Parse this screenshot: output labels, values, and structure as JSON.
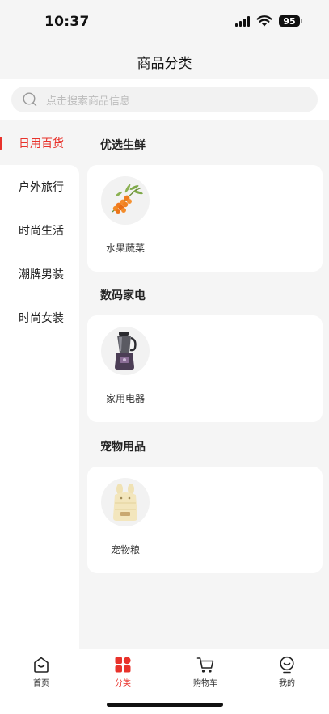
{
  "status_bar": {
    "time": "10:37",
    "battery": "95"
  },
  "header": {
    "title": "商品分类"
  },
  "search": {
    "placeholder": "点击搜索商品信息"
  },
  "sidebar": {
    "items": [
      {
        "label": "日用百货",
        "active": true
      },
      {
        "label": "户外旅行",
        "active": false
      },
      {
        "label": "时尚生活",
        "active": false
      },
      {
        "label": "潮牌男装",
        "active": false
      },
      {
        "label": "时尚女装",
        "active": false
      }
    ]
  },
  "sections": [
    {
      "title": "优选生鲜",
      "items": [
        {
          "label": "水果蔬菜",
          "icon": "sea-buckthorn-fruit-icon"
        }
      ]
    },
    {
      "title": "数码家电",
      "items": [
        {
          "label": "家用电器",
          "icon": "blender-icon"
        }
      ]
    },
    {
      "title": "宠物用品",
      "items": [
        {
          "label": "宠物粮",
          "icon": "pet-food-bag-icon"
        }
      ]
    }
  ],
  "tab_bar": {
    "tabs": [
      {
        "label": "首页",
        "icon": "home-icon",
        "active": false
      },
      {
        "label": "分类",
        "icon": "category-grid-icon",
        "active": true
      },
      {
        "label": "购物车",
        "icon": "cart-icon",
        "active": false
      },
      {
        "label": "我的",
        "icon": "profile-icon",
        "active": false
      }
    ]
  },
  "colors": {
    "accent": "#e8322b",
    "background": "#f5f5f5",
    "card": "#ffffff"
  }
}
